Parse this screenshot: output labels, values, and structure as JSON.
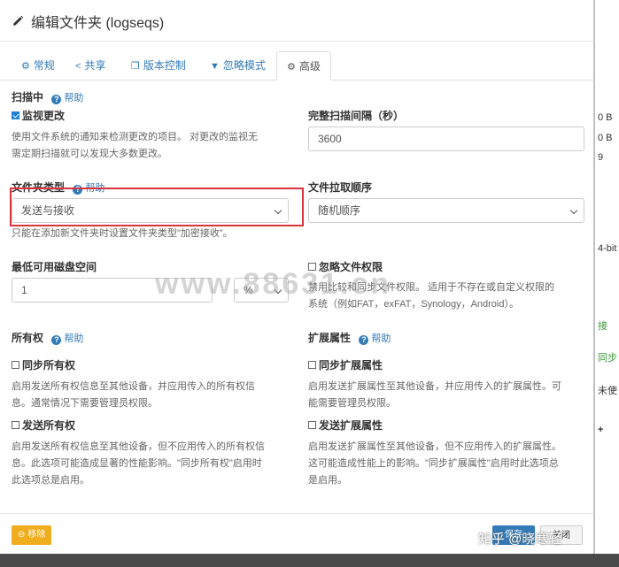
{
  "title": "编辑文件夹 (logseqs)",
  "tabs": [
    {
      "icon": "gear-icon",
      "label": "常规"
    },
    {
      "icon": "share-icon",
      "label": "共享"
    },
    {
      "icon": "copy-icon",
      "label": "版本控制"
    },
    {
      "icon": "filter-icon",
      "label": "忽略模式"
    },
    {
      "icon": "cogs-icon",
      "label": "高级"
    }
  ],
  "help_label": "帮助",
  "scanning": {
    "label": "扫描中",
    "watch_label": "监视更改",
    "watch_checked": true,
    "watch_desc_1": "使用文件系统的通知来检测更改的项目。 对更改的监视无",
    "watch_desc_2": "需定期扫描就可以发现大多数更改。"
  },
  "full_rescan": {
    "label": "完整扫描间隔（秒）",
    "value": "3600"
  },
  "folder_type": {
    "label": "文件夹类型",
    "value": "发送与接收",
    "note": "只能在添加新文件夹时设置文件夹类型\"加密接收\"。"
  },
  "pull_order": {
    "label": "文件拉取顺序",
    "value": "随机顺序"
  },
  "min_disk": {
    "label": "最低可用磁盘空间",
    "value": "1",
    "unit": "%"
  },
  "ignore_perms": {
    "label": "忽略文件权限",
    "checked": false,
    "desc_1": "禁用比较和同步文件权限。 适用于不存在或自定义权限的",
    "desc_2": "系统（例如FAT，exFAT，Synology，Android）。"
  },
  "ownership": {
    "label": "所有权",
    "sync_label": "同步所有权",
    "sync_desc_1": "启用发送所有权信息至其他设备，并应用传入的所有权信",
    "sync_desc_2": "息。通常情况下需要管理员权限。",
    "send_label": "发送所有权",
    "send_desc_1": "启用发送所有权信息至其他设备，但不应用传入的所有权信",
    "send_desc_2": "息。此选项可能造成显著的性能影响。\"同步所有权\"启用时",
    "send_desc_3": "此选项总是启用。"
  },
  "xattrs": {
    "label": "扩展属性",
    "sync_label": "同步扩展属性",
    "sync_desc_1": "启用发送扩展属性至其他设备，并应用传入的扩展属性。可",
    "sync_desc_2": "能需要管理员权限。",
    "send_label": "发送扩展属性",
    "send_desc_1": "启用发送扩展属性至其他设备，但不应用传入的扩展属性。",
    "send_desc_2": "这可能造成性能上的影响。\"同步扩展属性\"启用时此选项总",
    "send_desc_3": "是启用。"
  },
  "footer": {
    "remove_label": "移除",
    "save_label": "保存",
    "close_label": "关闭"
  },
  "watermark": "www.88631.cn",
  "attribution": "知乎 @晓寒轻",
  "background_fragments": [
    "0 B",
    "0 B",
    "9",
    "4-bit",
    "接",
    "同步",
    "未使",
    "+"
  ],
  "colors": {
    "accent": "#337ab7",
    "highlight": "#d9343e",
    "remove_btn": "#f0ad1e",
    "checkbox": "#1e7fd8"
  }
}
